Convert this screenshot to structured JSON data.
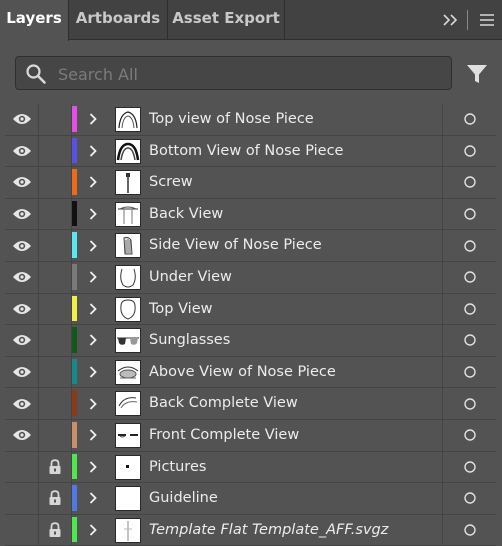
{
  "tabs": [
    {
      "label": "Layers",
      "active": true
    },
    {
      "label": "Artboards",
      "active": false
    },
    {
      "label": "Asset Export",
      "active": false
    }
  ],
  "tabbar_icons": {
    "overflow": "double-chevron-right-icon",
    "menu": "hamburger-menu-icon"
  },
  "search": {
    "placeholder": "Search All",
    "value": "",
    "icon": "search-icon"
  },
  "filter_icon": "filter-icon",
  "layers": [
    {
      "name": "Top view of Nose Piece",
      "color": "#e64fe6",
      "visible": true,
      "locked": false,
      "italic": false,
      "thumb": "nose-top"
    },
    {
      "name": "Bottom View of Nose Piece",
      "color": "#5a4fe6",
      "visible": true,
      "locked": false,
      "italic": false,
      "thumb": "nose-bottom"
    },
    {
      "name": "Screw",
      "color": "#ee6a1a",
      "visible": true,
      "locked": false,
      "italic": false,
      "thumb": "screw"
    },
    {
      "name": "Back View",
      "color": "#111111",
      "visible": true,
      "locked": false,
      "italic": false,
      "thumb": "back"
    },
    {
      "name": "Side View of Nose Piece",
      "color": "#5ee6f0",
      "visible": true,
      "locked": false,
      "italic": false,
      "thumb": "side"
    },
    {
      "name": "Under View",
      "color": "#7a7a7a",
      "visible": true,
      "locked": false,
      "italic": false,
      "thumb": "under"
    },
    {
      "name": "Top View",
      "color": "#f0f04a",
      "visible": true,
      "locked": false,
      "italic": false,
      "thumb": "top"
    },
    {
      "name": "Sunglasses",
      "color": "#0f5a1a",
      "visible": true,
      "locked": false,
      "italic": false,
      "thumb": "sunglasses"
    },
    {
      "name": "Above View of Nose Piece",
      "color": "#168a8a",
      "visible": true,
      "locked": false,
      "italic": false,
      "thumb": "above"
    },
    {
      "name": "Back Complete View",
      "color": "#8a3a14",
      "visible": true,
      "locked": false,
      "italic": false,
      "thumb": "back-complete"
    },
    {
      "name": "Front Complete View",
      "color": "#c8906a",
      "visible": true,
      "locked": false,
      "italic": false,
      "thumb": "front-complete"
    },
    {
      "name": "Pictures",
      "color": "#4fe64f",
      "visible": false,
      "locked": true,
      "italic": false,
      "thumb": "pictures"
    },
    {
      "name": "Guideline",
      "color": "#4f7ae6",
      "visible": false,
      "locked": true,
      "italic": false,
      "thumb": "blank"
    },
    {
      "name": "Template Flat Template_AFF.svgz",
      "color": "#4fe64f",
      "visible": false,
      "locked": true,
      "italic": true,
      "thumb": "template"
    }
  ]
}
